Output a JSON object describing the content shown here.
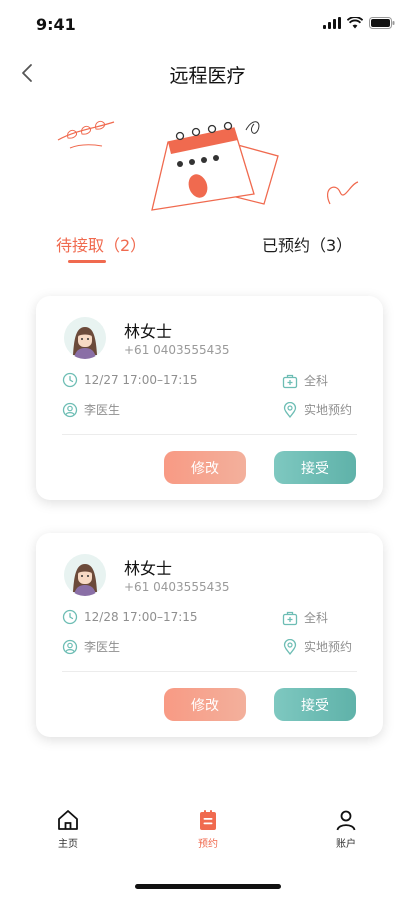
{
  "status_bar": {
    "time": "9:41",
    "icons": [
      "signal-icon",
      "wifi-icon",
      "battery-icon"
    ]
  },
  "nav": {
    "title": "远程医疗",
    "back_icon": "chevron-left-icon"
  },
  "hero": {
    "icon": "calendar-illustration"
  },
  "tabs": [
    {
      "label": "待接取（2）",
      "active": true
    },
    {
      "label": "已预约（3）",
      "active": false
    }
  ],
  "appointments": [
    {
      "name": "林女士",
      "phone": "+61 0403555435",
      "time": "12/27 17:00–17:15",
      "department": "全科",
      "doctor": "李医生",
      "mode": "实地预约",
      "edit_label": "修改",
      "accept_label": "接受"
    },
    {
      "name": "林女士",
      "phone": "+61 0403555435",
      "time": "12/28 17:00–17:15",
      "department": "全科",
      "doctor": "李医生",
      "mode": "实地预约",
      "edit_label": "修改",
      "accept_label": "接受"
    }
  ],
  "tabbar": [
    {
      "label": "主页",
      "icon": "home-icon",
      "active": false
    },
    {
      "label": "预约",
      "icon": "appointment-icon",
      "active": true
    },
    {
      "label": "账户",
      "icon": "user-icon",
      "active": false
    }
  ],
  "colors": {
    "accent": "#f06a4f",
    "teal": "#6dbdb4",
    "edit_button": "#f6a28d",
    "accept_button": "#6dbdb4"
  }
}
